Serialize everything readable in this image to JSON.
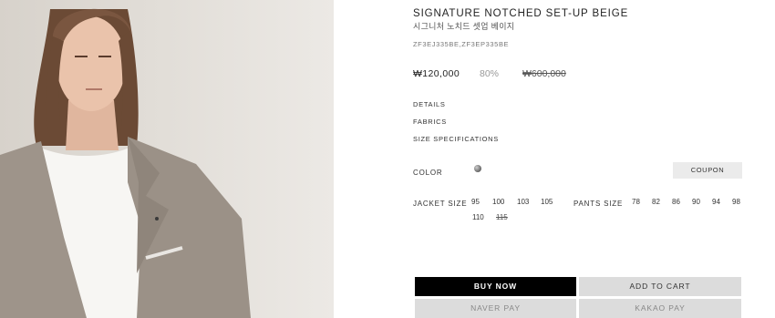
{
  "product": {
    "title": "SIGNATURE NOTCHED SET-UP BEIGE",
    "subtitle": "시그니처 노치드 셋업 베이지",
    "code": "ZF3EJ335BE,ZF3EP335BE",
    "price": "₩120,000",
    "discount": "80%",
    "original_price": "₩600,000"
  },
  "info_links": [
    "DETAILS",
    "FABRICS",
    "SIZE SPECIFICATIONS"
  ],
  "color": {
    "label": "COLOR",
    "swatch_color": "#6b6b6b"
  },
  "coupon_label": "COUPON",
  "jacket": {
    "label": "JACKET SIZE",
    "sizes": [
      "95",
      "100",
      "103",
      "105",
      "110",
      "115"
    ],
    "sold_out": [
      "115"
    ]
  },
  "pants": {
    "label": "PANTS SIZE",
    "sizes": [
      "78",
      "82",
      "86",
      "90",
      "94",
      "98"
    ]
  },
  "actions": {
    "buy_now": "BUY NOW",
    "add_to_cart": "ADD TO CART",
    "naver_pay": "NAVER PAY",
    "kakao_pay": "KAKAO PAY"
  },
  "colors": {
    "accent": "#000000",
    "button_gray": "#dcdcdc",
    "coupon_bg": "#ebebeb"
  }
}
